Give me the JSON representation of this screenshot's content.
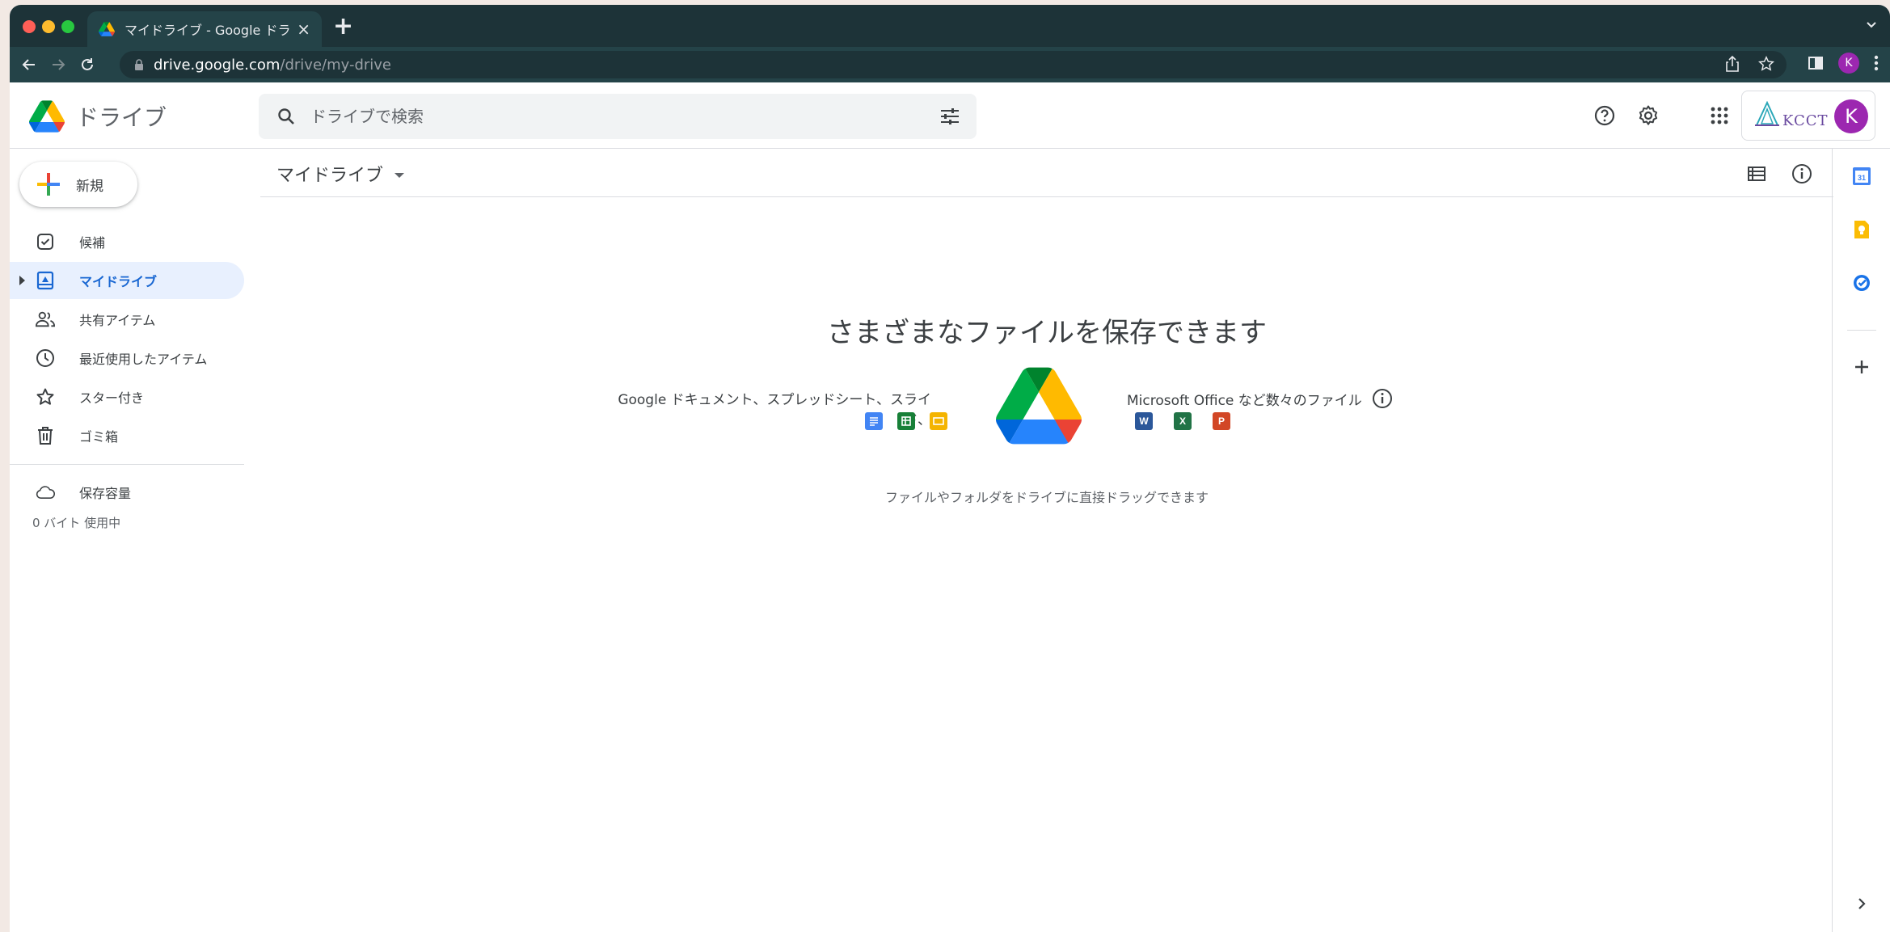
{
  "browser": {
    "tab_title": "マイドライブ - Google ドライブ",
    "tab_close": "×",
    "new_tab": "+",
    "url_host": "drive.google.com",
    "url_path": "/drive/my-drive",
    "profile_initial": "K"
  },
  "header": {
    "app_name": "ドライブ",
    "search_placeholder": "ドライブで検索",
    "org_logo_text": "KCCT",
    "account_initial": "K"
  },
  "sidebar": {
    "new_label": "新規",
    "items": [
      {
        "label": "候補",
        "icon": "check-square-icon"
      },
      {
        "label": "マイドライブ",
        "icon": "my-drive-icon",
        "active": true
      },
      {
        "label": "共有アイテム",
        "icon": "people-icon"
      },
      {
        "label": "最近使用したアイテム",
        "icon": "clock-icon"
      },
      {
        "label": "スター付き",
        "icon": "star-icon"
      },
      {
        "label": "ゴミ箱",
        "icon": "trash-icon"
      },
      {
        "label": "保存容量",
        "icon": "cloud-icon"
      }
    ],
    "storage_usage": "0 バイト 使用中"
  },
  "main": {
    "breadcrumb": "マイドライブ",
    "empty_title": "さまざまなファイルを保存できます",
    "promo_left": "Google ドキュメント、スプレッドシート、スライド、",
    "promo_right": "Microsoft Office など数々のファイル",
    "drop_hint": "ファイルやフォルダをドライブに直接ドラッグできます",
    "office_icons": [
      "W",
      "X",
      "P"
    ]
  },
  "colors": {
    "chrome_dark": "#1d3338",
    "active_nav_bg": "#e8f0fe",
    "active_nav_text": "#1967d2",
    "avatar": "#9c27b0",
    "docs_blue": "#4285f4",
    "sheets_green": "#188038",
    "slides_yellow": "#f4b400",
    "word_blue": "#2b579a",
    "excel_green": "#217346",
    "ppt_orange": "#d24726"
  }
}
